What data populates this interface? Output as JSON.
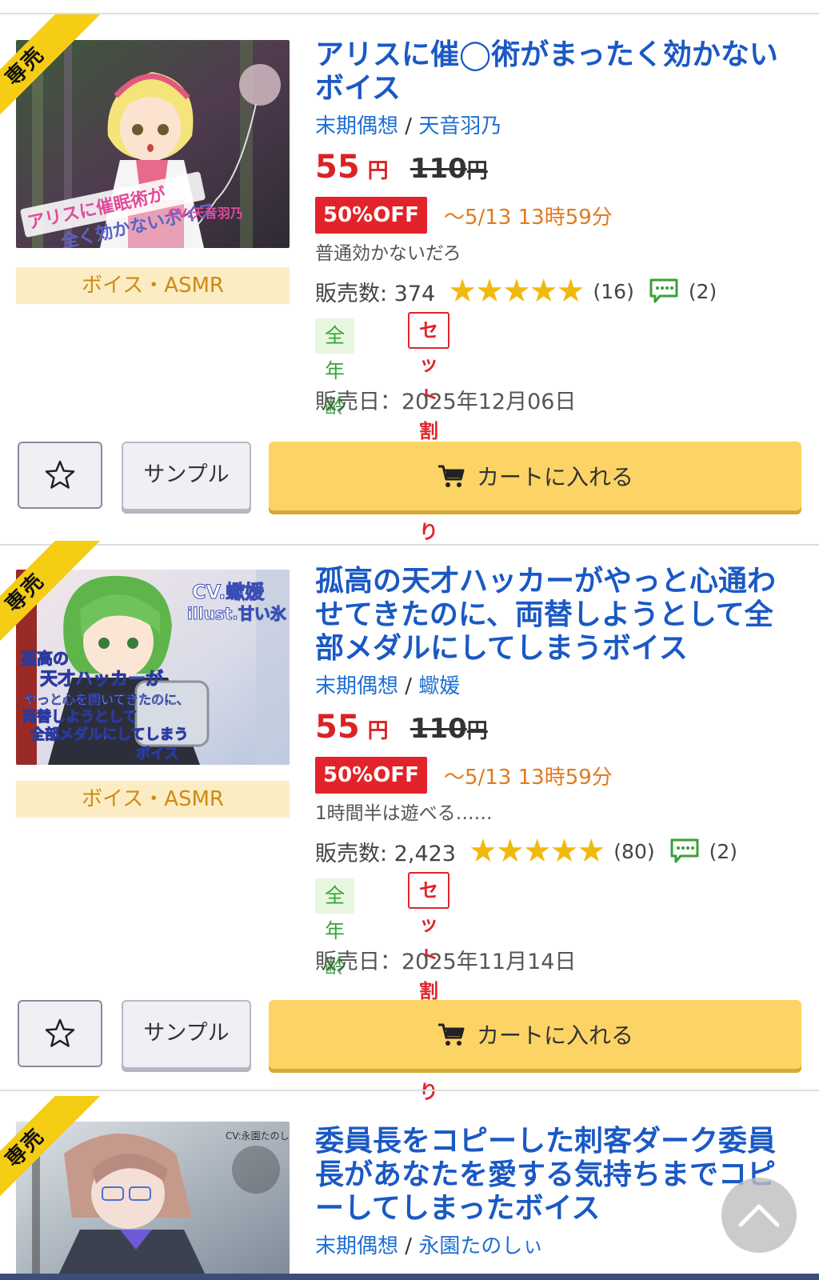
{
  "products": [
    {
      "badge": "専売",
      "genre": "ボイス・ASMR",
      "title": "アリスに催◯術がまったく効かないボイス",
      "circle": "末期偶想",
      "cv": "天音羽乃",
      "price": "55",
      "yen": "円",
      "old_price": "110",
      "old_yen": "円",
      "discount": "50%OFF",
      "until": "〜5/13 13時59分",
      "description": "普通効かないだろ",
      "sales_label": "販売数: 374",
      "rating_stars": 5,
      "review_count": "(16)",
      "comment_count": "(2)",
      "age_tag": "全年齢",
      "set_tag": "セット割引あり",
      "release_date": "販売日：2025年12月06日",
      "sample_label": "サンプル",
      "cart_label": "カートに入れる",
      "thumb_text": "アリスに催眠術が全く効かないボイス CV:天音羽乃"
    },
    {
      "badge": "専売",
      "genre": "ボイス・ASMR",
      "title": "孤高の天才ハッカーがやっと心通わせてきたのに、両替しようとして全部メダルにしてしまうボイス",
      "circle": "末期偶想",
      "cv": "蠍媛",
      "price": "55",
      "yen": "円",
      "old_price": "110",
      "old_yen": "円",
      "discount": "50%OFF",
      "until": "〜5/13 13時59分",
      "description": "1時間半は遊べる……",
      "sales_label": "販売数: 2,423",
      "rating_stars": 5,
      "review_count": "(80)",
      "comment_count": "(2)",
      "age_tag": "全年齢",
      "set_tag": "セット割引あり",
      "release_date": "販売日：2025年11月14日",
      "sample_label": "サンプル",
      "cart_label": "カートに入れる",
      "thumb_text": "CV.蠍媛 illust.甘い氷 孤高の天才ハッカーが… ボイス"
    },
    {
      "badge": "専売",
      "title": "委員長をコピーした刺客ダーク委員長があなたを愛する気持ちまでコピーしてしまったボイス",
      "circle": "末期偶想",
      "cv": "永園たのしぃ"
    }
  ],
  "colors": {
    "title": "#1a59c4",
    "price": "#dd2222",
    "discount_bg": "#e2232a",
    "until": "#e07a1e",
    "badge": "#f5cd14",
    "cart_button": "#fcd465",
    "genre_bg": "#fbecc4",
    "star": "#f1b90d"
  },
  "icons": {
    "favorite": "star-outline-icon",
    "cart": "cart-icon",
    "comment": "comment-icon",
    "scroll_top": "chevron-up-icon",
    "rating": "star-icon"
  }
}
